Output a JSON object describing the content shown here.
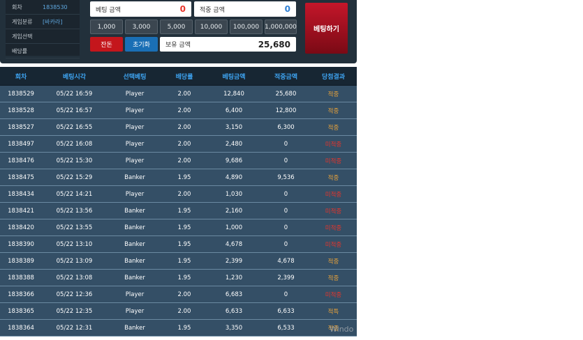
{
  "info": [
    {
      "label": "회차",
      "value": "1838530"
    },
    {
      "label": "게임분류",
      "value": "[바카라]"
    },
    {
      "label": "게임선택",
      "value": ""
    },
    {
      "label": "배당률",
      "value": ""
    }
  ],
  "bet_amount": {
    "label": "베팅 금액",
    "value": "0"
  },
  "win_amount": {
    "label": "적중 금액",
    "value": "0"
  },
  "chips": [
    "1,000",
    "3,000",
    "5,000",
    "10,000",
    "100,000",
    "1,000,000"
  ],
  "buttons": {
    "change": "잔돈",
    "reset": "초기화",
    "bet": "베팅하기"
  },
  "balance": {
    "label": "보유 금액",
    "value": "25,680"
  },
  "colors": {
    "accent": "#3ea3f0",
    "win": "#e8a23a",
    "lose": "#e8342a",
    "bet": "#b5121f"
  },
  "table": {
    "headers": [
      "회차",
      "베팅시각",
      "선택베팅",
      "배당률",
      "베팅금액",
      "적중금액",
      "당첨결과"
    ],
    "rows": [
      {
        "c": [
          "1838529",
          "05/22 16:59",
          "Player",
          "2.00",
          "12,840",
          "25,680",
          "적중"
        ],
        "s": "win"
      },
      {
        "c": [
          "1838528",
          "05/22 16:57",
          "Player",
          "2.00",
          "6,400",
          "12,800",
          "적중"
        ],
        "s": "win"
      },
      {
        "c": [
          "1838527",
          "05/22 16:55",
          "Player",
          "2.00",
          "3,150",
          "6,300",
          "적중"
        ],
        "s": "win"
      },
      {
        "c": [
          "1838497",
          "05/22 16:08",
          "Player",
          "2.00",
          "2,480",
          "0",
          "미적중"
        ],
        "s": "lose"
      },
      {
        "c": [
          "1838476",
          "05/22 15:30",
          "Player",
          "2.00",
          "9,686",
          "0",
          "미적중"
        ],
        "s": "lose"
      },
      {
        "c": [
          "1838475",
          "05/22 15:29",
          "Banker",
          "1.95",
          "4,890",
          "9,536",
          "적중"
        ],
        "s": "win"
      },
      {
        "c": [
          "1838434",
          "05/22 14:21",
          "Player",
          "2.00",
          "1,030",
          "0",
          "미적중"
        ],
        "s": "lose"
      },
      {
        "c": [
          "1838421",
          "05/22 13:56",
          "Banker",
          "1.95",
          "2,160",
          "0",
          "미적중"
        ],
        "s": "lose"
      },
      {
        "c": [
          "1838420",
          "05/22 13:55",
          "Banker",
          "1.95",
          "1,000",
          "0",
          "미적중"
        ],
        "s": "lose"
      },
      {
        "c": [
          "1838390",
          "05/22 13:10",
          "Banker",
          "1.95",
          "4,678",
          "0",
          "미적중"
        ],
        "s": "lose"
      },
      {
        "c": [
          "1838389",
          "05/22 13:09",
          "Banker",
          "1.95",
          "2,399",
          "4,678",
          "적중"
        ],
        "s": "win"
      },
      {
        "c": [
          "1838388",
          "05/22 13:08",
          "Banker",
          "1.95",
          "1,230",
          "2,399",
          "적중"
        ],
        "s": "win"
      },
      {
        "c": [
          "1838366",
          "05/22 12:36",
          "Player",
          "2.00",
          "6,683",
          "0",
          "미적중"
        ],
        "s": "lose"
      },
      {
        "c": [
          "1838365",
          "05/22 12:35",
          "Player",
          "2.00",
          "6,633",
          "6,633",
          "적특"
        ],
        "s": "win"
      },
      {
        "c": [
          "1838364",
          "05/22 12:31",
          "Banker",
          "1.95",
          "3,350",
          "6,533",
          "적중"
        ],
        "s": "win"
      }
    ]
  },
  "watermark": "Windo"
}
